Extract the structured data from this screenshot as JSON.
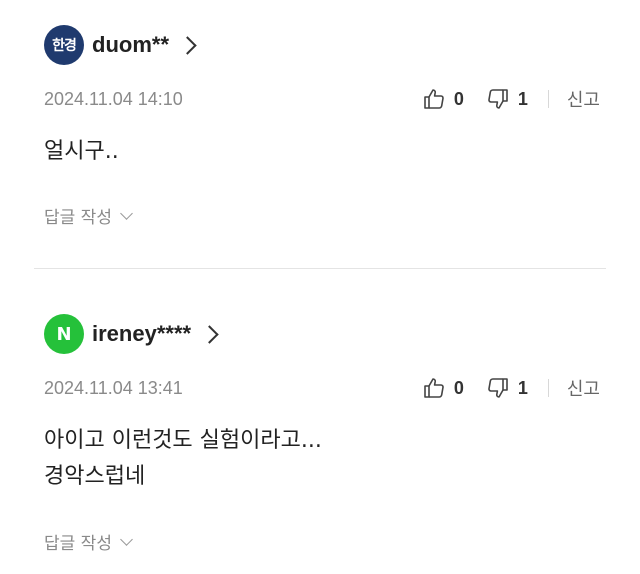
{
  "comments": [
    {
      "avatar_text": "한경",
      "avatar_color": "#1f3a6e",
      "username": "duom**",
      "date": "2024.11.04 14:10",
      "likes": "0",
      "dislikes": "1",
      "report_label": "신고",
      "body_lines": [
        "얼시구.."
      ],
      "reply_label": "답글 작성"
    },
    {
      "avatar_text": "N",
      "avatar_color": "#25c13a",
      "username": "ireney****",
      "date": "2024.11.04 13:41",
      "likes": "0",
      "dislikes": "1",
      "report_label": "신고",
      "body_lines": [
        "아이고 이런것도 실험이라고...",
        "경악스럽네"
      ],
      "reply_label": "답글 작성"
    }
  ],
  "icons": {
    "like": "thumbs-up-icon",
    "dislike": "thumbs-down-icon"
  }
}
